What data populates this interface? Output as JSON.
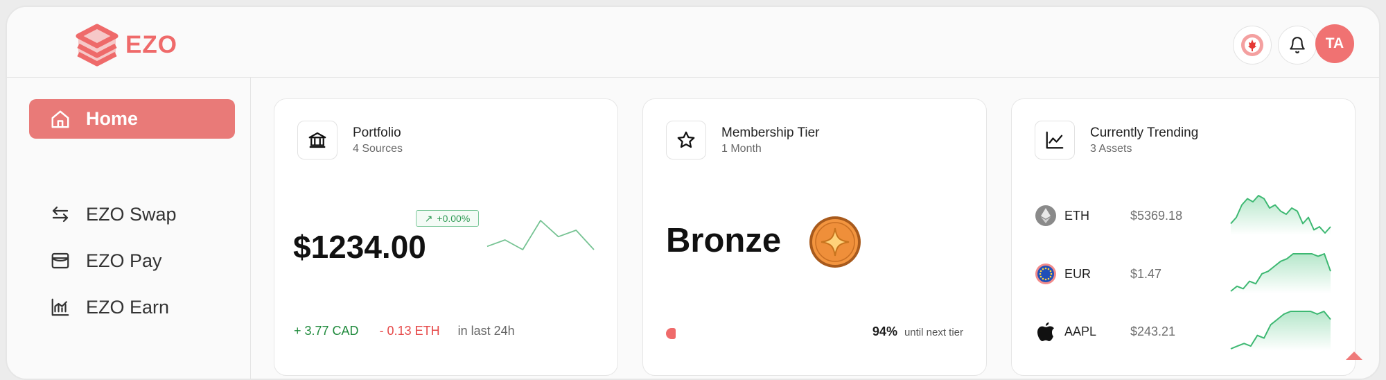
{
  "app": {
    "name": "EZO",
    "brand_color": "#ef6a6a"
  },
  "header": {
    "region_icon": "canada-flag-icon",
    "notifications_icon": "bell-icon",
    "avatar_initials": "TA"
  },
  "sidebar": {
    "items": [
      {
        "label": "Home",
        "icon": "home-icon",
        "active": true
      },
      {
        "label": "EZO Swap",
        "icon": "swap-arrows-icon",
        "active": false
      },
      {
        "label": "EZO Pay",
        "icon": "wallet-icon",
        "active": false
      },
      {
        "label": "EZO Earn",
        "icon": "chart-icon",
        "active": false
      }
    ]
  },
  "portfolio": {
    "title": "Portfolio",
    "subtitle": "4 Sources",
    "icon": "bank-icon",
    "balance": "$1234.00",
    "change": "+0.00%",
    "gain": "+ 3.77 CAD",
    "loss": "- 0.13 ETH",
    "period": "in last 24h",
    "sparkline": [
      2,
      4,
      1,
      10,
      5,
      7,
      1
    ]
  },
  "membership": {
    "title": "Membership Tier",
    "subtitle": "1 Month",
    "icon": "star-icon",
    "tier": "Bronze",
    "percent": "94%",
    "percent_note": "until next tier"
  },
  "trending": {
    "title": "Currently Trending",
    "subtitle": "3 Assets",
    "icon": "line-chart-icon",
    "assets": [
      {
        "symbol": "ETH",
        "price": "$5369.18",
        "icon": "ethereum-icon",
        "sparkline": [
          3,
          5,
          9,
          11,
          10,
          12,
          11,
          8,
          9,
          7,
          6,
          8,
          7,
          3,
          5,
          1,
          2,
          0,
          2
        ]
      },
      {
        "symbol": "EUR",
        "price": "$1.47",
        "icon": "eu-flag-icon",
        "sparkline": [
          0,
          2,
          1,
          4,
          3,
          7,
          8,
          10,
          12,
          13,
          15,
          15,
          15,
          15,
          14,
          15,
          8
        ]
      },
      {
        "symbol": "AAPL",
        "price": "$243.21",
        "icon": "apple-icon",
        "sparkline": [
          0,
          1,
          2,
          1,
          5,
          4,
          9,
          11,
          13,
          14,
          14,
          14,
          14,
          13,
          14,
          11
        ]
      }
    ]
  }
}
